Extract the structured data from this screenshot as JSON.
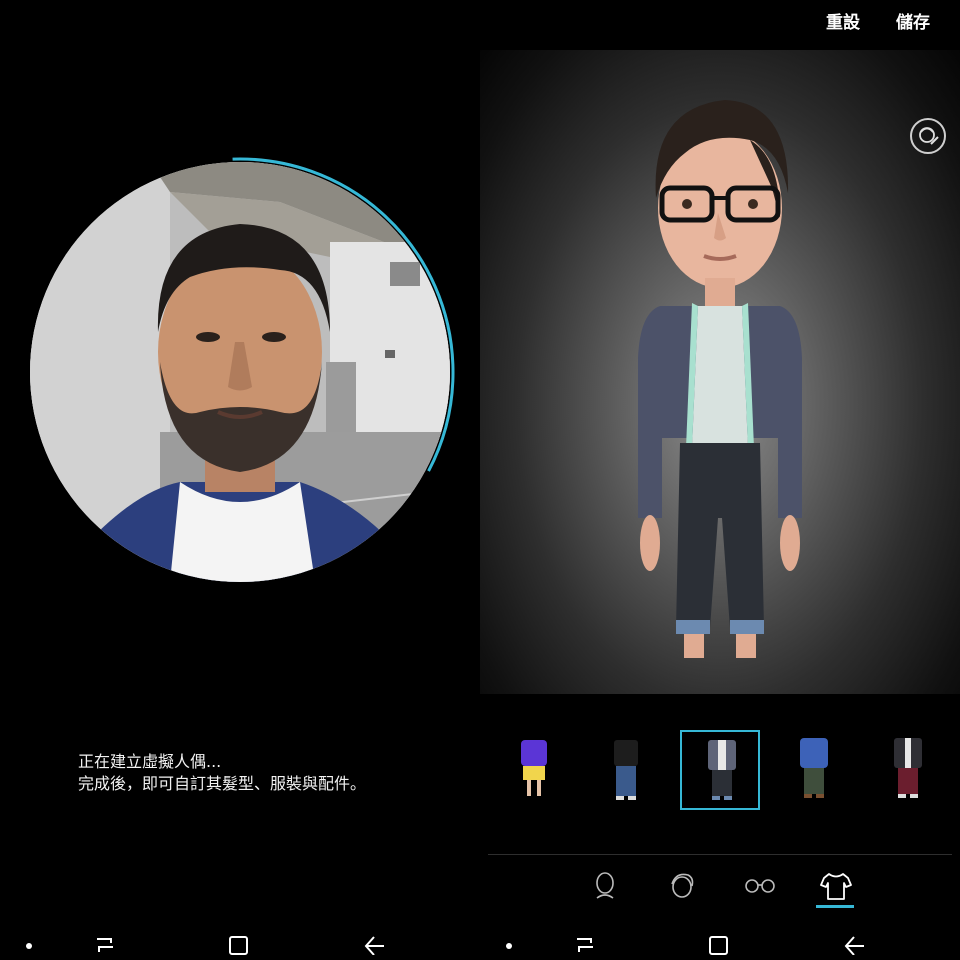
{
  "status": {
    "line1": "正在建立虛擬人偶...",
    "line2": "完成後，即可自訂其髮型、服裝與配件。"
  },
  "header": {
    "reset_label": "重設",
    "save_label": "儲存"
  },
  "outfits": [
    {
      "name": "purple-shirt-yellow-shorts"
    },
    {
      "name": "black-tee-blue-jeans"
    },
    {
      "name": "jacket-white-tee-dark-jeans",
      "selected": true
    },
    {
      "name": "denim-jacket-green-pants"
    },
    {
      "name": "dark-blazer-maroon-pants"
    }
  ],
  "category_tabs": [
    {
      "name": "face-icon"
    },
    {
      "name": "hair-icon"
    },
    {
      "name": "glasses-icon"
    },
    {
      "name": "clothing-icon",
      "selected": true
    }
  ],
  "colors": {
    "accent": "#36b8d6",
    "background": "#000000"
  }
}
